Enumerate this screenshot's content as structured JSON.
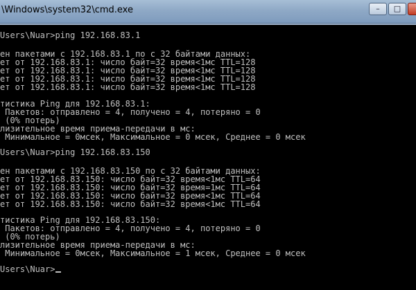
{
  "window": {
    "title": "\\Windows\\system32\\cmd.exe",
    "minimize_glyph": "–",
    "maximize_glyph": "□",
    "close_glyph": "✕"
  },
  "console": {
    "lines": [
      "Users\\Nuar>ping 192.168.83.1",
      "",
      "ен пакетами с 192.168.83.1 по с 32 байтами данных:",
      "ет от 192.168.83.1: число байт=32 время<1мс TTL=128",
      "ет от 192.168.83.1: число байт=32 время<1мс TTL=128",
      "ет от 192.168.83.1: число байт=32 время<1мс TTL=128",
      "ет от 192.168.83.1: число байт=32 время<1мс TTL=128",
      "",
      "тистика Ping для 192.168.83.1:",
      " Пакетов: отправлено = 4, получено = 4, потеряно = 0",
      " (0% потерь)",
      "лизительное время приема-передачи в мс:",
      " Минимальное = 0мсек, Максимальное = 0 мсек, Среднее = 0 мсек",
      "",
      "Users\\Nuar>ping 192.168.83.150",
      "",
      "ен пакетами с 192.168.83.150 по с 32 байтами данных:",
      "ет от 192.168.83.150: число байт=32 время<1мс TTL=64",
      "ет от 192.168.83.150: число байт=32 время=1мс TTL=64",
      "ет от 192.168.83.150: число байт=32 время<1мс TTL=64",
      "ет от 192.168.83.150: число байт=32 время<1мс TTL=64",
      "",
      "тистика Ping для 192.168.83.150:",
      " Пакетов: отправлено = 4, получено = 4, потеряно = 0",
      " (0% потерь)",
      "лизительное время приема-передачи в мс:",
      " Минимальное = 0мсек, Максимальное = 1 мсек, Среднее = 0 мсек",
      "",
      "Users\\Nuar>"
    ]
  }
}
